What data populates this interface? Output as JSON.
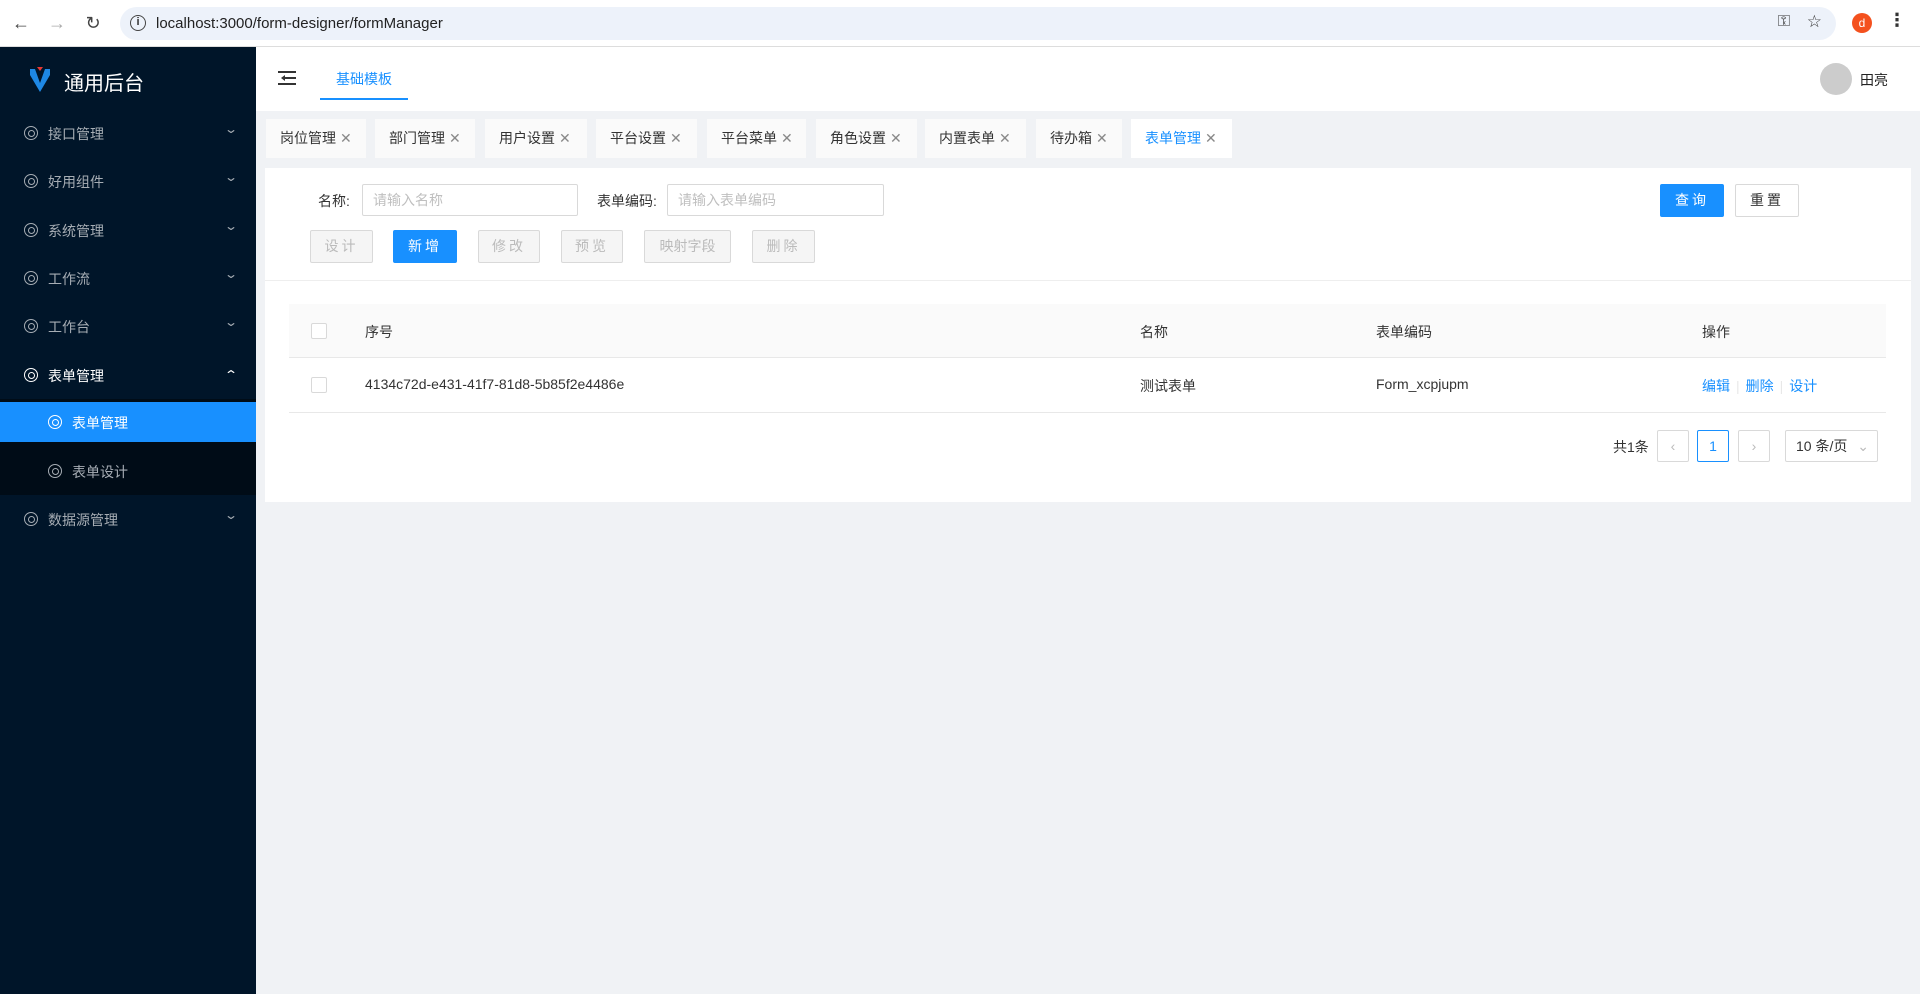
{
  "browser": {
    "url": "localhost:3000/form-designer/formManager",
    "profile_initial": "d"
  },
  "brand": {
    "title": "通用后台"
  },
  "sidebar": {
    "items": [
      {
        "label": "接口管理"
      },
      {
        "label": "好用组件"
      },
      {
        "label": "系统管理"
      },
      {
        "label": "工作流"
      },
      {
        "label": "工作台"
      },
      {
        "label": "表单管理"
      },
      {
        "label": "表单管理"
      },
      {
        "label": "表单设计"
      },
      {
        "label": "数据源管理"
      }
    ]
  },
  "header": {
    "top_tab": "基础模板",
    "user": "田亮"
  },
  "tabs": [
    {
      "label": "岗位管理"
    },
    {
      "label": "部门管理"
    },
    {
      "label": "用户设置"
    },
    {
      "label": "平台设置"
    },
    {
      "label": "平台菜单"
    },
    {
      "label": "角色设置"
    },
    {
      "label": "内置表单"
    },
    {
      "label": "待办箱"
    },
    {
      "label": "表单管理"
    }
  ],
  "tab_close": "✕",
  "search": {
    "name_label": "名称:",
    "name_placeholder": "请输入名称",
    "code_label": "表单编码:",
    "code_placeholder": "请输入表单编码",
    "query": "查询",
    "reset": "重置"
  },
  "toolbar": {
    "design": "设计",
    "add": "新增",
    "edit": "修改",
    "preview": "预览",
    "map": "映射字段",
    "delete": "删除"
  },
  "table": {
    "headers": [
      "序号",
      "名称",
      "表单编码",
      "操作"
    ],
    "rows": [
      {
        "id": "4134c72d-e431-41f7-81d8-5b85f2e4486e",
        "name": "测试表单",
        "code": "Form_xcpjupm",
        "actions": [
          "编辑",
          "删除",
          "设计"
        ]
      }
    ]
  },
  "pagination": {
    "total": "共1条",
    "current": "1",
    "page_size": "10 条/页"
  },
  "colors": {
    "accent": "#1890ff",
    "sidebar": "#001529"
  }
}
